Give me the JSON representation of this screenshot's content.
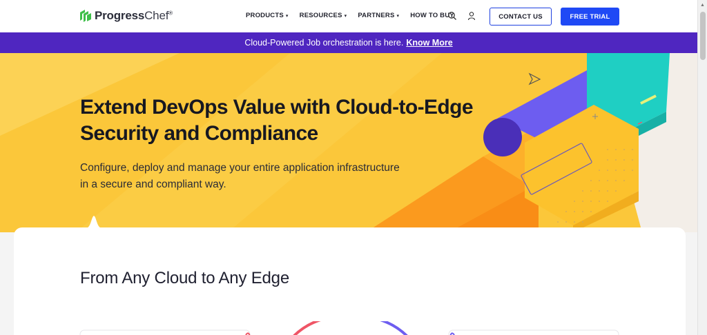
{
  "header": {
    "logo": {
      "brand": "Progress",
      "product": "Chef",
      "tm": "®"
    },
    "nav": [
      {
        "label": "PRODUCTS",
        "dropdown": true
      },
      {
        "label": "RESOURCES",
        "dropdown": true
      },
      {
        "label": "PARTNERS",
        "dropdown": true
      },
      {
        "label": "HOW TO BUY",
        "dropdown": false
      }
    ],
    "caret": "▾",
    "contact_label": "CONTACT US",
    "trial_label": "FREE TRIAL",
    "search_icon": "search-icon",
    "user_icon": "user-icon"
  },
  "banner": {
    "text": "Cloud-Powered Job orchestration is here.",
    "link_label": "Know More"
  },
  "hero": {
    "title_line1": "Extend DevOps Value with Cloud-to-Edge",
    "title_line2": "Security and Compliance",
    "subtitle_line1": "Configure, deploy and manage your entire application infrastructure",
    "subtitle_line2": "in a secure and compliant way."
  },
  "section": {
    "title": "From Any Cloud to Any Edge"
  },
  "colors": {
    "accent_blue": "#1f49f5",
    "banner_purple": "#4f26c0",
    "hero_yellow": "#fbc73a",
    "logo_green": "#3fbf4a"
  }
}
